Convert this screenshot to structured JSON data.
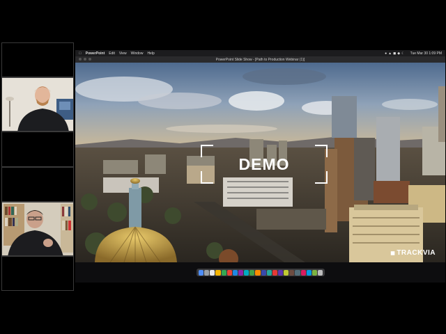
{
  "menubar": {
    "app": "PowerPoint",
    "items": [
      "Edit",
      "View",
      "Window",
      "Help"
    ],
    "clock": "Tue Mar 30  1:09 PM"
  },
  "window": {
    "title": "PowerPoint Slide Show - [Path to Production Webinar (1)]"
  },
  "slide": {
    "headline": "DEMO",
    "brand": "TRACKVIA"
  },
  "dock": {
    "icon_colors": [
      "#4f8ef7",
      "#9aa0a6",
      "#e9e9e9",
      "#f4b400",
      "#34a853",
      "#ea4335",
      "#1e88e5",
      "#8e24aa",
      "#00acc1",
      "#43a047",
      "#fb8c00",
      "#3949ab",
      "#26a69a",
      "#e53935",
      "#5e35b1",
      "#c0ca33",
      "#6d4c41",
      "#546e7a",
      "#d81b60",
      "#039be5",
      "#7cb342",
      "#bdbdbd"
    ]
  }
}
